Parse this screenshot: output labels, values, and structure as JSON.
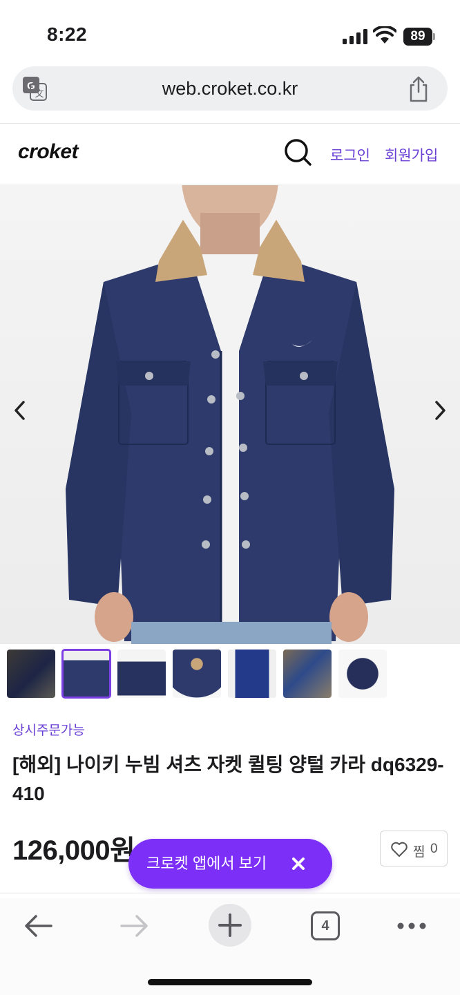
{
  "status_bar": {
    "time": "8:22",
    "battery": "89"
  },
  "browser": {
    "url": "web.croket.co.kr",
    "open_tabs": "4"
  },
  "site": {
    "logo": "croket",
    "login_label": "로그인",
    "signup_label": "회원가입"
  },
  "product": {
    "tag": "상시주문가능",
    "title": "[해외] 나이키 누빔 셔츠 자켓 퀼팅 양털 카라 dq6329-410",
    "price": "126,000원",
    "wish_label": "찜",
    "wish_count": "0",
    "selected_thumbnail": 2,
    "thumbnail_count": 7
  },
  "app_banner": {
    "label": "크로켓 앱에서 보기"
  },
  "colors": {
    "accent": "#7b2ff7",
    "link": "#6a3fd6",
    "jacket_navy": "#2d3a6b",
    "collar_sherpa": "#c9a57a"
  },
  "icons": {
    "translate": "translate-icon",
    "share": "share-icon",
    "search": "search-icon",
    "prev": "chevron-left-icon",
    "next": "chevron-right-icon",
    "wish": "heart-icon",
    "close": "close-icon",
    "back": "arrow-left-icon",
    "forward": "arrow-right-icon",
    "new_tab": "plus-icon",
    "more": "more-icon"
  }
}
